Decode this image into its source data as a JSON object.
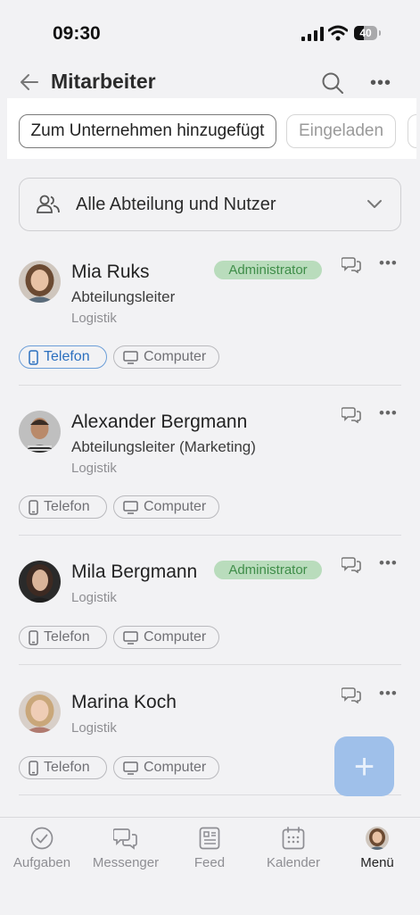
{
  "status_bar": {
    "time": "09:30",
    "battery": "40"
  },
  "header": {
    "title": "Mitarbeiter"
  },
  "tabs": [
    {
      "label": "Zum Unternehmen hinzugefügt",
      "active": true
    },
    {
      "label": "Eingeladen",
      "active": false
    }
  ],
  "filter": {
    "label": "Alle Abteilung und Nutzer"
  },
  "employees": [
    {
      "name": "Mia Ruks",
      "role": "Abteilungsleiter",
      "department": "Logistik",
      "badge": "Administrator",
      "chip_phone": "Telefon",
      "chip_computer": "Computer",
      "phone_active": true
    },
    {
      "name": "Alexander Bergmann",
      "role": "Abteilungsleiter (Marketing)",
      "department": "Logistik",
      "chip_phone": "Telefon",
      "chip_computer": "Computer"
    },
    {
      "name": "Mila Bergmann",
      "department": "Logistik",
      "badge": "Administrator",
      "chip_phone": "Telefon",
      "chip_computer": "Computer"
    },
    {
      "name": "Marina Koch",
      "department": "Logistik",
      "chip_phone": "Telefon",
      "chip_computer": "Computer"
    }
  ],
  "fab": {
    "icon": "plus-icon"
  },
  "nav": [
    {
      "label": "Aufgaben",
      "icon": "check-circle-icon"
    },
    {
      "label": "Messenger",
      "icon": "chat-bubbles-icon"
    },
    {
      "label": "Feed",
      "icon": "feed-icon"
    },
    {
      "label": "Kalender",
      "icon": "calendar-icon"
    },
    {
      "label": "Menü",
      "icon": "avatar",
      "active": true
    }
  ],
  "colors": {
    "accent": "#2b6fbf",
    "badge_bg": "#b9dcbc",
    "badge_text": "#3f8d49",
    "fab": "#9fc0ea"
  }
}
